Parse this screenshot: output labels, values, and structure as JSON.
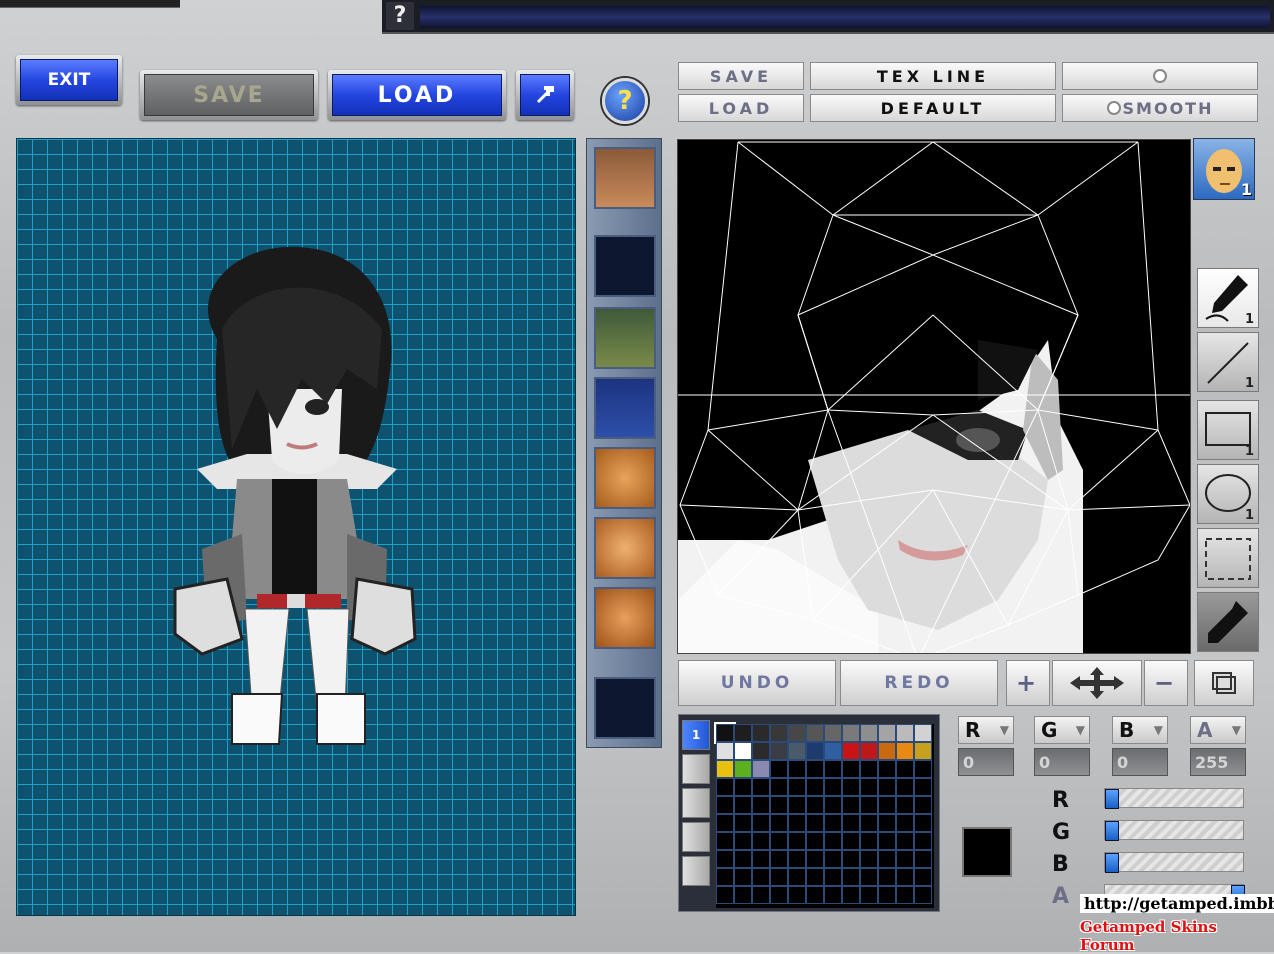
{
  "left_toolbar": {
    "exit_label": "EXIT",
    "save_label": "SAVE",
    "load_label": "LOAD"
  },
  "texture_toolbar": {
    "save_label": "SAVE",
    "load_label": "LOAD",
    "texline_label": "TEX LINE",
    "default_label": "DEFAULT",
    "smooth_label": "SMOOTH"
  },
  "part_selector": {
    "badge": "1"
  },
  "tools": [
    {
      "name": "pen",
      "count": "1"
    },
    {
      "name": "line",
      "count": "1"
    },
    {
      "name": "rectangle",
      "count": "1"
    },
    {
      "name": "ellipse",
      "count": "1"
    },
    {
      "name": "select",
      "count": ""
    },
    {
      "name": "eyedropper",
      "count": ""
    }
  ],
  "edit_row": {
    "undo_label": "UNDO",
    "redo_label": "REDO",
    "zoom_in": "+",
    "zoom_out": "−"
  },
  "palette": {
    "tab_label": "1",
    "colors_row1": [
      "#111111",
      "#1e1e1e",
      "#2a2a2a",
      "#383838",
      "#474747",
      "#565656",
      "#666666",
      "#7a7a7a",
      "#8e8e8e",
      "#a4a4a4",
      "#bbbbbb",
      "#d2d2d2"
    ],
    "colors_row2": [
      "#e0e0e0",
      "#ffffff",
      "#2b2b2b",
      "#3a3d44",
      "#4a5a6a",
      "#1d3b6e",
      "#2f5fa0",
      "#c81414",
      "#c01818",
      "#c96a10",
      "#e88a12",
      "#c8a020"
    ],
    "colors_row3": [
      "#e8c010",
      "#5cb020",
      "#8a8ab0"
    ]
  },
  "color_channels": {
    "r": {
      "label": "R",
      "value": "0"
    },
    "g": {
      "label": "G",
      "value": "0"
    },
    "b": {
      "label": "B",
      "value": "0"
    },
    "a": {
      "label": "A",
      "value": "255"
    }
  },
  "sliders": [
    {
      "label": "R",
      "level": 0
    },
    {
      "label": "G",
      "level": 0
    },
    {
      "label": "B",
      "level": 0
    },
    {
      "label": "A",
      "level": 1
    }
  ],
  "current_color": "#000000",
  "watermark": {
    "url": "http://getamped.imbbs.in",
    "forum": "Getamped Skins Forum"
  },
  "colors": {
    "accent_blue": "#2446e0",
    "grid_bg": "#0d5370",
    "grid_line": "#1fa0c9"
  }
}
